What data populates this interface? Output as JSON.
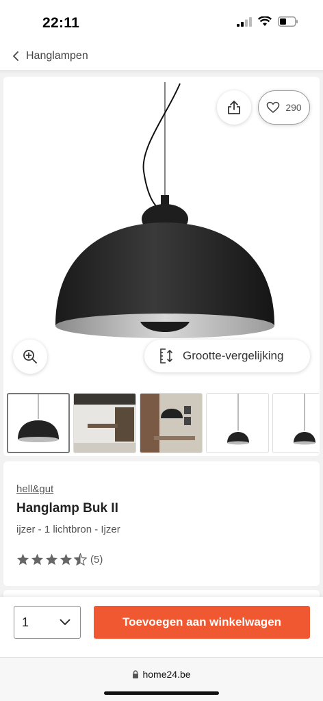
{
  "status_bar": {
    "time": "22:11"
  },
  "breadcrumb": {
    "label": "Hanglampen"
  },
  "gallery": {
    "favorite_count": "290",
    "compare_label": "Grootte-vergelijking"
  },
  "product": {
    "brand": "hell&gut",
    "title": "Hanglamp Buk II",
    "subtitle": "ijzer - 1 lichtbron - Ijzer",
    "rating": 4.5,
    "rating_max": 5,
    "review_count": "(5)"
  },
  "purchase": {
    "quantity": "1",
    "add_to_cart_label": "Toevoegen aan winkelwagen",
    "accent_color": "#ef5830"
  },
  "browser": {
    "url": "home24.be"
  },
  "icons": [
    "chevron-left-icon",
    "share-icon",
    "heart-icon",
    "zoom-in-icon",
    "size-compare-icon",
    "star-icon",
    "star-half-icon",
    "chevron-down-icon",
    "lock-icon"
  ]
}
